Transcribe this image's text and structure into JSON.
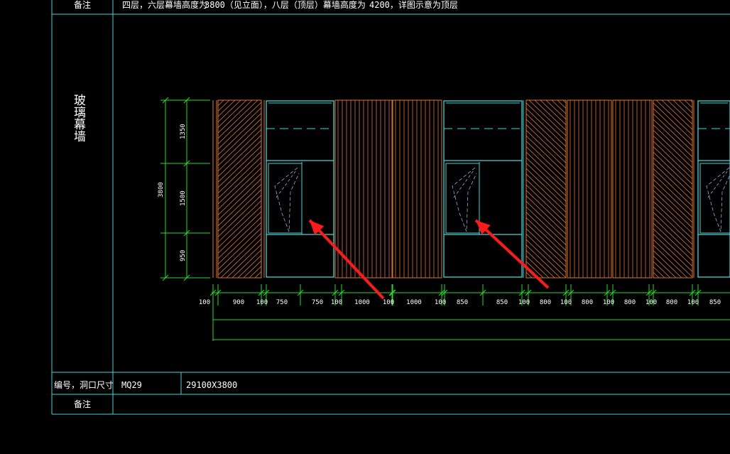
{
  "header_row": {
    "label": "备注",
    "note_part1": "四层，六层幕墙高度为",
    "note_val1": "3800（见立面），八层（顶层）幕墙高度为",
    "note_val2": "4200，详图示意为顶层"
  },
  "elevation": {
    "title": "玻璃幕墙",
    "total_height": "3800",
    "vertical_segments": [
      "1350",
      "1500",
      "950"
    ],
    "horizontal_dims": [
      "100",
      "900",
      "100",
      "750",
      "750",
      "100",
      "1000",
      "100",
      "1000",
      "100",
      "850",
      "850",
      "100",
      "800",
      "100",
      "800",
      "100",
      "800",
      "100",
      "800",
      "100",
      "850"
    ]
  },
  "table": {
    "code_label": "编号，洞口尺寸",
    "code_value": "MQ29",
    "size_value": "29100X3800",
    "remark_label": "备注",
    "remark_value": ""
  },
  "colors": {
    "frame": "#3fd6d6",
    "panel": "#e0732a",
    "dimension": "#20e020",
    "arrow": "#ff1a1a"
  }
}
